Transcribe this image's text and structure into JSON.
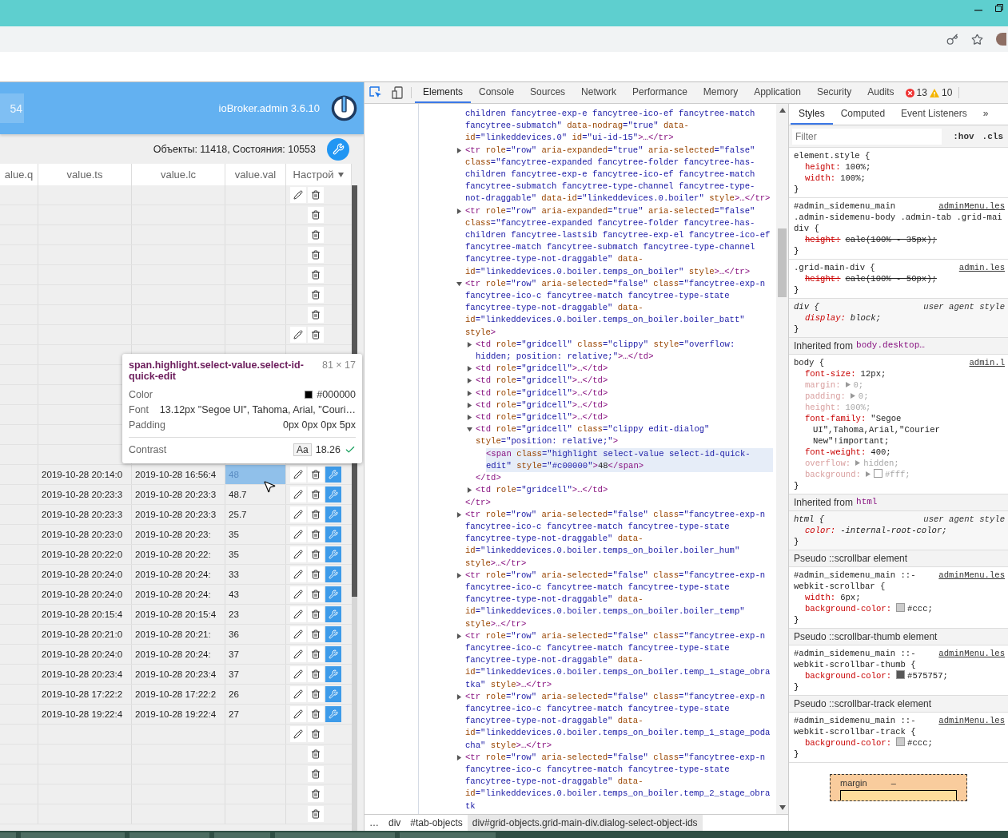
{
  "app": {
    "search_value": "54",
    "version": "ioBroker.admin 3.6.10",
    "counts": "Объекты: 11418, Состояния: 10553",
    "columns": [
      "alue.q",
      "value.ts",
      "value.lc",
      "value.val",
      "Настрой"
    ],
    "rows": [
      {
        "edit": true,
        "remove": true,
        "settings": false
      },
      {
        "edit": false,
        "remove": true,
        "settings": false
      },
      {
        "edit": false,
        "remove": true,
        "settings": false
      },
      {
        "edit": false,
        "remove": true,
        "settings": false
      },
      {
        "edit": false,
        "remove": true,
        "settings": false
      },
      {
        "edit": false,
        "remove": true,
        "settings": false
      },
      {
        "edit": false,
        "remove": true,
        "settings": false
      },
      {
        "edit": true,
        "remove": true,
        "settings": false
      },
      {
        "edit": false,
        "remove": false,
        "settings": false
      },
      {
        "edit": false,
        "remove": false,
        "settings": false
      },
      {
        "edit": false,
        "remove": false,
        "settings": false
      },
      {
        "edit": false,
        "remove": false,
        "settings": false
      },
      {
        "edit": false,
        "remove": false,
        "settings": false
      },
      {
        "edit": false,
        "remove": false,
        "settings": false
      },
      {
        "ts": "2019-10-28 20:14:0",
        "lc": "2019-10-28 16:56:4",
        "val": "48",
        "selected": true,
        "edit": true,
        "remove": true,
        "settings": true
      },
      {
        "ts": "2019-10-28 20:23:3",
        "lc": "2019-10-28 20:23:3",
        "val": "48.7",
        "selected": false,
        "edit": true,
        "remove": true,
        "settings": true
      },
      {
        "ts": "2019-10-28 20:23:3",
        "lc": "2019-10-28 20:23:3",
        "val": "25.7",
        "selected": false,
        "edit": true,
        "remove": true,
        "settings": true
      },
      {
        "ts": "2019-10-28 20:23:0",
        "lc": "2019-10-28 20:23:",
        "val": "35",
        "selected": false,
        "edit": true,
        "remove": true,
        "settings": true
      },
      {
        "ts": "2019-10-28 20:22:0",
        "lc": "2019-10-28 20:22:",
        "val": "35",
        "selected": false,
        "edit": true,
        "remove": true,
        "settings": true
      },
      {
        "ts": "2019-10-28 20:24:0",
        "lc": "2019-10-28 20:24:",
        "val": "33",
        "selected": false,
        "edit": true,
        "remove": true,
        "settings": true
      },
      {
        "ts": "2019-10-28 20:24:0",
        "lc": "2019-10-28 20:24:",
        "val": "43",
        "selected": false,
        "edit": true,
        "remove": true,
        "settings": true
      },
      {
        "ts": "2019-10-28 20:15:4",
        "lc": "2019-10-28 20:15:4",
        "val": "23",
        "selected": false,
        "edit": true,
        "remove": true,
        "settings": true
      },
      {
        "ts": "2019-10-28 20:21:0",
        "lc": "2019-10-28 20:21:",
        "val": "36",
        "selected": false,
        "edit": true,
        "remove": true,
        "settings": true
      },
      {
        "ts": "2019-10-28 20:24:0",
        "lc": "2019-10-28 20:24:",
        "val": "37",
        "selected": false,
        "edit": true,
        "remove": true,
        "settings": true
      },
      {
        "ts": "2019-10-28 20:23:4",
        "lc": "2019-10-28 20:23:4",
        "val": "37",
        "selected": false,
        "edit": true,
        "remove": true,
        "settings": true
      },
      {
        "ts": "2019-10-28 17:22:2",
        "lc": "2019-10-28 17:22:2",
        "val": "26",
        "selected": false,
        "edit": true,
        "remove": true,
        "settings": true
      },
      {
        "ts": "2019-10-28 19:22:4",
        "lc": "2019-10-28 19:22:4",
        "val": "27",
        "selected": false,
        "edit": true,
        "remove": true,
        "settings": true
      },
      {
        "edit": true,
        "remove": true,
        "settings": false
      },
      {
        "edit": false,
        "remove": true,
        "settings": false
      },
      {
        "edit": false,
        "remove": true,
        "settings": false
      },
      {
        "edit": false,
        "remove": true,
        "settings": false
      },
      {
        "edit": false,
        "remove": true,
        "settings": false
      }
    ],
    "tooltip": {
      "selector": "span.highlight.select-value.select-id-quick-edit",
      "size": "81 × 17",
      "rows": [
        {
          "label": "Color",
          "value": "#000000",
          "color": "#000000"
        },
        {
          "label": "Font",
          "value": "13.12px \"Segoe UI\", Tahoma, Arial, \"Couri…"
        },
        {
          "label": "Padding",
          "value": "0px 0px 0px 5px"
        }
      ],
      "contrast": {
        "label": "Contrast",
        "sample": "Aa",
        "value": "18.26"
      }
    }
  },
  "devtools": {
    "tabs": [
      {
        "label": "Elements",
        "selected": true
      },
      {
        "label": "Console",
        "selected": false
      },
      {
        "label": "Sources",
        "selected": false
      },
      {
        "label": "Network",
        "selected": false
      },
      {
        "label": "Performance",
        "selected": false
      },
      {
        "label": "Memory",
        "selected": false
      },
      {
        "label": "Application",
        "selected": false
      },
      {
        "label": "Security",
        "selected": false
      },
      {
        "label": "Audits",
        "selected": false
      }
    ],
    "errors": "13",
    "warnings": "10",
    "nodes": [
      {
        "kind": "plain",
        "selected": false,
        "tokens": [
          {
            "kind": "val",
            "text": "children fancytree-exp-e fancytree-ico-ef fancytree-match fancytree-submatch\""
          },
          {
            "kind": "attr",
            "text": " data-nodrag"
          },
          {
            "kind": "val",
            "text": "=\"true\""
          },
          {
            "kind": "attr",
            "text": " data-id"
          },
          {
            "kind": "val",
            "text": "=\"linkeddevices.0\""
          },
          {
            "kind": "attr",
            "text": " id"
          },
          {
            "kind": "val",
            "text": "=\"ui-id-15\""
          },
          {
            "kind": "tag",
            "text": ">…</tr>"
          }
        ]
      },
      {
        "kind": "toggle",
        "expanded": false,
        "selected": false,
        "tokens": [
          {
            "kind": "tag",
            "text": "<tr"
          },
          {
            "kind": "attr",
            "text": " role"
          },
          {
            "kind": "val",
            "text": "=\"row\""
          },
          {
            "kind": "attr",
            "text": " aria-expanded"
          },
          {
            "kind": "val",
            "text": "=\"true\""
          },
          {
            "kind": "attr",
            "text": " aria-selected"
          },
          {
            "kind": "val",
            "text": "=\"false\""
          },
          {
            "kind": "attr",
            "text": " class"
          },
          {
            "kind": "val",
            "text": "=\"fancytree-expanded fancytree-folder fancytree-has-children fancytree-exp-e fancytree-ico-ef fancytree-match fancytree-submatch fancytree-type-channel fancytree-type-not-draggable\""
          },
          {
            "kind": "attr",
            "text": " data-id"
          },
          {
            "kind": "val",
            "text": "=\"linkeddevices.0.boiler\""
          },
          {
            "kind": "attr",
            "text": " style"
          },
          {
            "kind": "tag",
            "text": ">…</tr>"
          }
        ]
      },
      {
        "kind": "toggle",
        "expanded": false,
        "selected": false,
        "tokens": [
          {
            "kind": "tag",
            "text": "<tr"
          },
          {
            "kind": "attr",
            "text": " role"
          },
          {
            "kind": "val",
            "text": "=\"row\""
          },
          {
            "kind": "attr",
            "text": " aria-expanded"
          },
          {
            "kind": "val",
            "text": "=\"true\""
          },
          {
            "kind": "attr",
            "text": " aria-selected"
          },
          {
            "kind": "val",
            "text": "=\"false\""
          },
          {
            "kind": "attr",
            "text": " class"
          },
          {
            "kind": "val",
            "text": "=\"fancytree-expanded fancytree-folder fancytree-has-children fancytree-lastsib fancytree-exp-el fancytree-ico-ef fancytree-match fancytree-submatch fancytree-type-channel fancytree-type-not-draggable\""
          },
          {
            "kind": "attr",
            "text": " data-id"
          },
          {
            "kind": "val",
            "text": "=\"linkeddevices.0.boiler.temps_on_boiler\""
          },
          {
            "kind": "attr",
            "text": " style"
          },
          {
            "kind": "tag",
            "text": ">…</tr>"
          }
        ]
      },
      {
        "kind": "toggle",
        "expanded": true,
        "selected": false,
        "closing": "</tr>",
        "tokens": [
          {
            "kind": "tag",
            "text": "<tr"
          },
          {
            "kind": "attr",
            "text": " role"
          },
          {
            "kind": "val",
            "text": "=\"row\""
          },
          {
            "kind": "attr",
            "text": " aria-selected"
          },
          {
            "kind": "val",
            "text": "=\"false\""
          },
          {
            "kind": "attr",
            "text": " class"
          },
          {
            "kind": "val",
            "text": "=\"fancytree-exp-n fancytree-ico-c fancytree-match fancytree-type-state fancytree-type-not-draggable\""
          },
          {
            "kind": "attr",
            "text": " data-id"
          },
          {
            "kind": "val",
            "text": "=\"linkeddevices.0.boiler.temps_on_boiler.boiler_batt\""
          },
          {
            "kind": "attr",
            "text": " style"
          },
          {
            "kind": "tag",
            "text": ">"
          }
        ],
        "children": [
          {
            "kind": "toggle",
            "expanded": false,
            "selected": false,
            "tokens": [
              {
                "kind": "tag",
                "text": "<td"
              },
              {
                "kind": "attr",
                "text": " role"
              },
              {
                "kind": "val",
                "text": "=\"gridcell\""
              },
              {
                "kind": "attr",
                "text": " class"
              },
              {
                "kind": "val",
                "text": "=\"clippy\""
              },
              {
                "kind": "attr",
                "text": " style"
              },
              {
                "kind": "val",
                "text": "=\"overflow: hidden; position: relative;\""
              },
              {
                "kind": "tag",
                "text": ">…</td>"
              }
            ]
          },
          {
            "kind": "toggle",
            "expanded": false,
            "selected": false,
            "tokens": [
              {
                "kind": "tag",
                "text": "<td"
              },
              {
                "kind": "attr",
                "text": " role"
              },
              {
                "kind": "val",
                "text": "=\"gridcell\""
              },
              {
                "kind": "tag",
                "text": ">…</td>"
              }
            ]
          },
          {
            "kind": "toggle",
            "expanded": false,
            "selected": false,
            "tokens": [
              {
                "kind": "tag",
                "text": "<td"
              },
              {
                "kind": "attr",
                "text": " role"
              },
              {
                "kind": "val",
                "text": "=\"gridcell\""
              },
              {
                "kind": "tag",
                "text": ">…</td>"
              }
            ]
          },
          {
            "kind": "toggle",
            "expanded": false,
            "selected": false,
            "tokens": [
              {
                "kind": "tag",
                "text": "<td"
              },
              {
                "kind": "attr",
                "text": " role"
              },
              {
                "kind": "val",
                "text": "=\"gridcell\""
              },
              {
                "kind": "tag",
                "text": ">…</td>"
              }
            ]
          },
          {
            "kind": "toggle",
            "expanded": false,
            "selected": false,
            "tokens": [
              {
                "kind": "tag",
                "text": "<td"
              },
              {
                "kind": "attr",
                "text": " role"
              },
              {
                "kind": "val",
                "text": "=\"gridcell\""
              },
              {
                "kind": "tag",
                "text": ">…</td>"
              }
            ]
          },
          {
            "kind": "toggle",
            "expanded": false,
            "selected": false,
            "tokens": [
              {
                "kind": "tag",
                "text": "<td"
              },
              {
                "kind": "attr",
                "text": " role"
              },
              {
                "kind": "val",
                "text": "=\"gridcell\""
              },
              {
                "kind": "tag",
                "text": ">…</td>"
              }
            ]
          },
          {
            "kind": "toggle",
            "expanded": true,
            "selected": false,
            "closing": "</td>",
            "tokens": [
              {
                "kind": "tag",
                "text": "<td"
              },
              {
                "kind": "attr",
                "text": " role"
              },
              {
                "kind": "val",
                "text": "=\"gridcell\""
              },
              {
                "kind": "attr",
                "text": " class"
              },
              {
                "kind": "val",
                "text": "=\"clippy edit-dialog\""
              },
              {
                "kind": "attr",
                "text": " style"
              },
              {
                "kind": "val",
                "text": "=\"position: relative;\""
              },
              {
                "kind": "tag",
                "text": ">"
              }
            ],
            "children": [
              {
                "kind": "plain",
                "selected": true,
                "tokens": [
                  {
                    "kind": "tag",
                    "text": "<span"
                  },
                  {
                    "kind": "attr",
                    "text": " class"
                  },
                  {
                    "kind": "val",
                    "text": "=\"highlight select-value select-id-quick-edit\""
                  },
                  {
                    "kind": "attr",
                    "text": " style"
                  },
                  {
                    "kind": "val",
                    "text": "=\"#c00000\""
                  },
                  {
                    "kind": "tag",
                    "text": ">"
                  },
                  {
                    "kind": "text",
                    "text": "48"
                  },
                  {
                    "kind": "tag",
                    "text": "</span>"
                  }
                ]
              }
            ]
          },
          {
            "kind": "toggle",
            "expanded": false,
            "selected": false,
            "tokens": [
              {
                "kind": "tag",
                "text": "<td"
              },
              {
                "kind": "attr",
                "text": " role"
              },
              {
                "kind": "val",
                "text": "=\"gridcell\""
              },
              {
                "kind": "tag",
                "text": ">…</td>"
              }
            ]
          }
        ]
      },
      {
        "kind": "toggle",
        "expanded": false,
        "selected": false,
        "tokens": [
          {
            "kind": "tag",
            "text": "<tr"
          },
          {
            "kind": "attr",
            "text": " role"
          },
          {
            "kind": "val",
            "text": "=\"row\""
          },
          {
            "kind": "attr",
            "text": " aria-selected"
          },
          {
            "kind": "val",
            "text": "=\"false\""
          },
          {
            "kind": "attr",
            "text": " class"
          },
          {
            "kind": "val",
            "text": "=\"fancytree-exp-n fancytree-ico-c fancytree-match fancytree-type-state fancytree-type-not-draggable\""
          },
          {
            "kind": "attr",
            "text": " data-id"
          },
          {
            "kind": "val",
            "text": "=\"linkeddevices.0.boiler.temps_on_boiler.boiler_hum\""
          },
          {
            "kind": "attr",
            "text": " style"
          },
          {
            "kind": "tag",
            "text": ">…</tr>"
          }
        ]
      },
      {
        "kind": "toggle",
        "expanded": false,
        "selected": false,
        "tokens": [
          {
            "kind": "tag",
            "text": "<tr"
          },
          {
            "kind": "attr",
            "text": " role"
          },
          {
            "kind": "val",
            "text": "=\"row\""
          },
          {
            "kind": "attr",
            "text": " aria-selected"
          },
          {
            "kind": "val",
            "text": "=\"false\""
          },
          {
            "kind": "attr",
            "text": " class"
          },
          {
            "kind": "val",
            "text": "=\"fancytree-exp-n fancytree-ico-c fancytree-match fancytree-type-state fancytree-type-not-draggable\""
          },
          {
            "kind": "attr",
            "text": " data-id"
          },
          {
            "kind": "val",
            "text": "=\"linkeddevices.0.boiler.temps_on_boiler.boiler_temp\""
          },
          {
            "kind": "attr",
            "text": " style"
          },
          {
            "kind": "tag",
            "text": ">…</tr>"
          }
        ]
      },
      {
        "kind": "toggle",
        "expanded": false,
        "selected": false,
        "tokens": [
          {
            "kind": "tag",
            "text": "<tr"
          },
          {
            "kind": "attr",
            "text": " role"
          },
          {
            "kind": "val",
            "text": "=\"row\""
          },
          {
            "kind": "attr",
            "text": " aria-selected"
          },
          {
            "kind": "val",
            "text": "=\"false\""
          },
          {
            "kind": "attr",
            "text": " class"
          },
          {
            "kind": "val",
            "text": "=\"fancytree-exp-n fancytree-ico-c fancytree-match fancytree-type-state fancytree-type-not-draggable\""
          },
          {
            "kind": "attr",
            "text": " data-id"
          },
          {
            "kind": "val",
            "text": "=\"linkeddevices.0.boiler.temps_on_boiler.temp_1_stage_obratka\""
          },
          {
            "kind": "attr",
            "text": " style"
          },
          {
            "kind": "tag",
            "text": ">…</tr>"
          }
        ]
      },
      {
        "kind": "toggle",
        "expanded": false,
        "selected": false,
        "tokens": [
          {
            "kind": "tag",
            "text": "<tr"
          },
          {
            "kind": "attr",
            "text": " role"
          },
          {
            "kind": "val",
            "text": "=\"row\""
          },
          {
            "kind": "attr",
            "text": " aria-selected"
          },
          {
            "kind": "val",
            "text": "=\"false\""
          },
          {
            "kind": "attr",
            "text": " class"
          },
          {
            "kind": "val",
            "text": "=\"fancytree-exp-n fancytree-ico-c fancytree-match fancytree-type-state fancytree-type-not-draggable\""
          },
          {
            "kind": "attr",
            "text": " data-id"
          },
          {
            "kind": "val",
            "text": "=\"linkeddevices.0.boiler.temps_on_boiler.temp_1_stage_podacha\""
          },
          {
            "kind": "attr",
            "text": " style"
          },
          {
            "kind": "tag",
            "text": ">…</tr>"
          }
        ]
      },
      {
        "kind": "toggle",
        "expanded": false,
        "selected": false,
        "tokens": [
          {
            "kind": "tag",
            "text": "<tr"
          },
          {
            "kind": "attr",
            "text": " role"
          },
          {
            "kind": "val",
            "text": "=\"row\""
          },
          {
            "kind": "attr",
            "text": " aria-selected"
          },
          {
            "kind": "val",
            "text": "=\"false\""
          },
          {
            "kind": "attr",
            "text": " class"
          },
          {
            "kind": "val",
            "text": "=\"fancytree-exp-n fancytree-ico-c fancytree-match fancytree-type-state fancytree-type-not-draggable\""
          },
          {
            "kind": "attr",
            "text": " data-id"
          },
          {
            "kind": "val",
            "text": "=\"linkeddevices.0.boiler.temps_on_boiler.temp_2_stage_obratk"
          }
        ]
      }
    ],
    "breadcrumbs": [
      {
        "label": "…",
        "selected": false
      },
      {
        "label": "div",
        "selected": false
      },
      {
        "label": "#tab-objects",
        "selected": false
      },
      {
        "label": "div#grid-objects.grid-main-div.dialog-select-object-ids",
        "selected": true
      }
    ],
    "styles": {
      "tabs": [
        {
          "label": "Styles",
          "selected": true
        },
        {
          "label": "Computed",
          "selected": false
        },
        {
          "label": "Event Listeners",
          "selected": false
        }
      ],
      "more": "»",
      "filter": {
        "placeholder": "Filter"
      },
      "toggles": [
        ":hov",
        ".cls"
      ],
      "sections": [
        {
          "kind": "rule",
          "ua": false,
          "selector": [
            "element.style {"
          ],
          "close": "}",
          "decls": [
            {
              "prop": "height:",
              "value": "100%;",
              "struck": false,
              "dim": false
            },
            {
              "prop": "width:",
              "value": "100%;",
              "struck": false,
              "dim": false
            }
          ]
        },
        {
          "kind": "rule",
          "ua": false,
          "selector": [
            "#admin_sidemenu_main",
            ".admin-sidemenu-body .admin-tab .grid-mai",
            "div {"
          ],
          "source": "adminMenu.les",
          "close": "}",
          "decls": [
            {
              "prop": "height:",
              "value": "calc(100% - 35px);",
              "struck": true,
              "dim": false
            }
          ]
        },
        {
          "kind": "rule",
          "ua": false,
          "selector": [
            ".grid-main-div {"
          ],
          "source": "admin.les",
          "close": "}",
          "decls": [
            {
              "prop": "height:",
              "value": "calc(100% - 50px);",
              "struck": true,
              "dim": false
            }
          ]
        },
        {
          "kind": "rule",
          "ua": true,
          "selector": [
            "div {"
          ],
          "source": "user agent style",
          "close": "}",
          "decls": [
            {
              "prop": "display:",
              "value": "block;",
              "struck": false,
              "dim": false
            }
          ]
        },
        {
          "kind": "header",
          "text": "Inherited from",
          "target": "body.desktop…"
        },
        {
          "kind": "rule",
          "ua": false,
          "selector": [
            "body {"
          ],
          "source": "admin.l",
          "close": "}",
          "decls": [
            {
              "prop": "font-size:",
              "value": "12px;",
              "struck": false,
              "dim": false
            },
            {
              "prop": "margin:",
              "value": "0;",
              "struck": false,
              "dim": true,
              "expandable": true
            },
            {
              "prop": "padding:",
              "value": "0;",
              "struck": false,
              "dim": true,
              "expandable": true
            },
            {
              "prop": "height:",
              "value": "100%;",
              "struck": false,
              "dim": true
            },
            {
              "prop": "font-family:",
              "value": "\"Segoe UI\",Tahoma,Arial,\"Courier New\"!important;",
              "struck": false,
              "dim": false
            },
            {
              "prop": "font-weight:",
              "value": "400;",
              "struck": false,
              "dim": false
            },
            {
              "prop": "overflow:",
              "value": "hidden;",
              "struck": false,
              "dim": true,
              "expandable": true
            },
            {
              "prop": "background:",
              "value": "#fff;",
              "struck": false,
              "dim": true,
              "expandable": true,
              "color": "#ffffff"
            }
          ]
        },
        {
          "kind": "header",
          "text": "Inherited from",
          "target": "html"
        },
        {
          "kind": "rule",
          "ua": true,
          "selector": [
            "html {"
          ],
          "source": "user agent style",
          "close": "}",
          "decls": [
            {
              "prop": "color:",
              "value": "-internal-root-color;",
              "struck": false,
              "dim": false
            }
          ]
        },
        {
          "kind": "header",
          "text": "Pseudo ::scrollbar element"
        },
        {
          "kind": "rule",
          "ua": false,
          "selector": [
            "#admin_sidemenu_main ::-",
            "webkit-scrollbar {"
          ],
          "source": "adminMenu.les",
          "close": "}",
          "decls": [
            {
              "prop": "width:",
              "value": "6px;",
              "struck": false,
              "dim": false
            },
            {
              "prop": "background-color:",
              "value": "#ccc;",
              "struck": false,
              "dim": false,
              "color": "#cccccc"
            }
          ]
        },
        {
          "kind": "header",
          "text": "Pseudo ::scrollbar-thumb element"
        },
        {
          "kind": "rule",
          "ua": false,
          "selector": [
            "#admin_sidemenu_main ::-",
            "webkit-scrollbar-thumb {"
          ],
          "source": "adminMenu.les",
          "close": "}",
          "decls": [
            {
              "prop": "background-color:",
              "value": "#575757;",
              "struck": false,
              "dim": false,
              "color": "#575757"
            }
          ]
        },
        {
          "kind": "header",
          "text": "Pseudo ::scrollbar-track element"
        },
        {
          "kind": "rule",
          "ua": false,
          "selector": [
            "#admin_sidemenu_main ::-",
            "webkit-scrollbar-track {"
          ],
          "source": "adminMenu.les",
          "close": "}",
          "decls": [
            {
              "prop": "background-color:",
              "value": "#ccc;",
              "struck": false,
              "dim": false,
              "color": "#cccccc"
            }
          ]
        },
        {
          "kind": "boxmodel",
          "labels": [
            "margin",
            "–"
          ]
        }
      ]
    }
  }
}
